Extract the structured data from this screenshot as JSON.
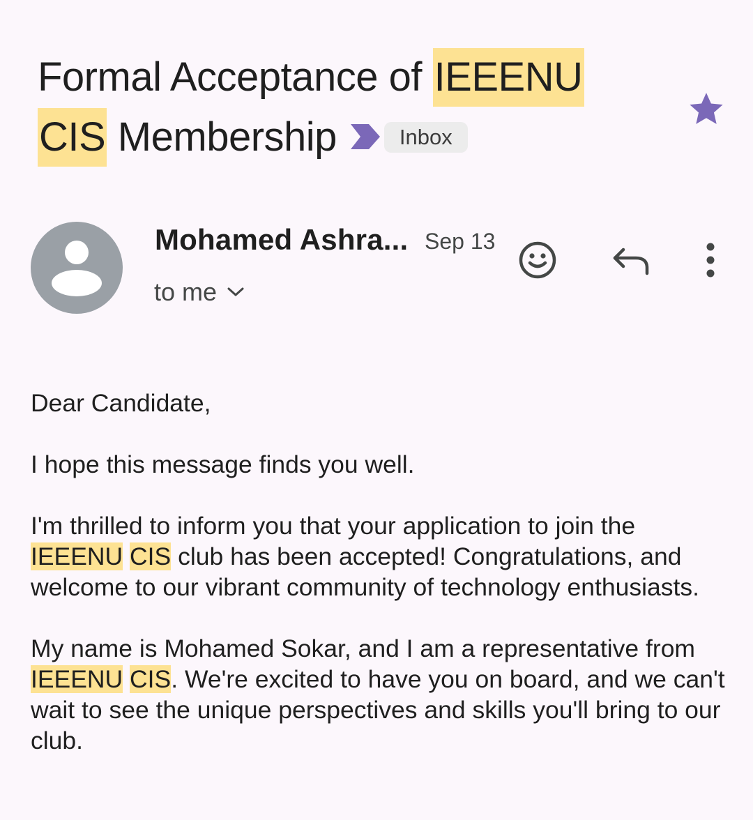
{
  "email": {
    "subject_part1": "Formal Acceptance of ",
    "subject_hl1": "IEEENU",
    "subject_hl2": "CIS",
    "subject_part2": " Membership",
    "label_chip": "Inbox",
    "starred": true,
    "sender_name": "Mohamed Ashra...",
    "date": "Sep 13",
    "recipient": "to me",
    "body": {
      "greeting": "Dear Candidate,",
      "line1": "I hope this message finds you well.",
      "p2_a": "I'm thrilled to inform you that your application to join the ",
      "p2_hl1": "IEEENU",
      "p2_hl2": "CIS",
      "p2_b": " club has been accepted! Congratulations, and welcome to our vibrant community of technology enthusiasts.",
      "p3_a": "My name is Mohamed Sokar, and I am a representative from ",
      "p3_hl1": "IEEENU",
      "p3_hl2": "CIS",
      "p3_b": ". We're excited to have you on board, and we can't wait to see the unique perspectives and skills you'll bring to our club."
    }
  },
  "icons": {
    "important": "important-marker-icon",
    "star": "star-icon",
    "avatar": "avatar-icon",
    "expand": "chevron-down-icon",
    "emoji": "emoji-reaction-icon",
    "reply": "reply-icon",
    "more": "more-vert-icon"
  },
  "colors": {
    "background": "#fcf7fc",
    "highlight": "#fde293",
    "accent_purple": "#7b68b8",
    "avatar_gray": "#9aa0a6",
    "chip_bg": "#ececec"
  }
}
